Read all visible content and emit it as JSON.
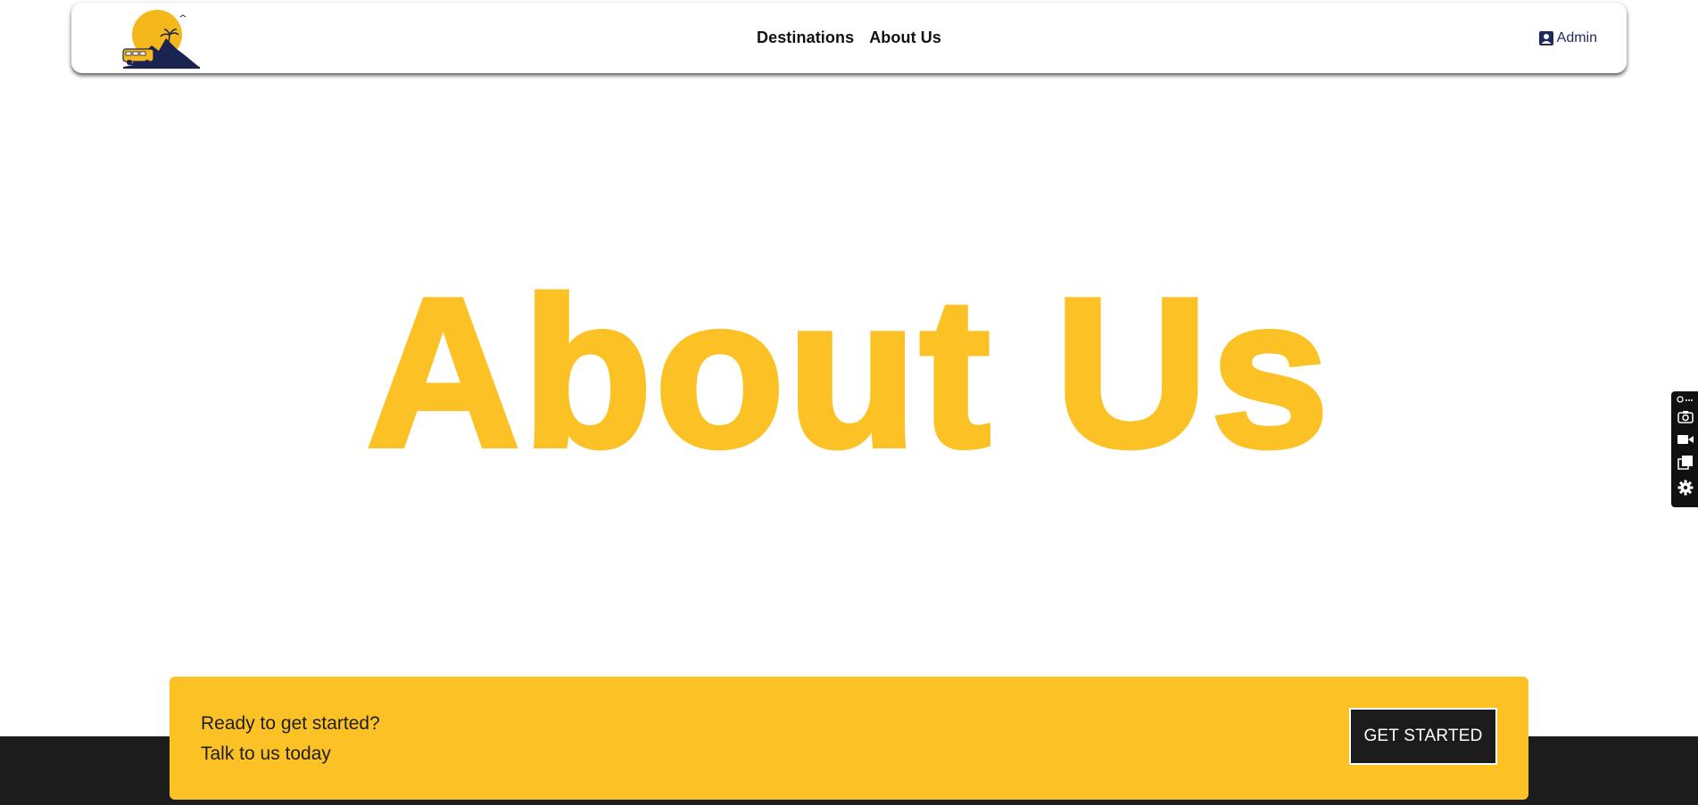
{
  "header": {
    "logo_name": "sunset-van-logo",
    "nav": [
      {
        "label": "Destinations"
      },
      {
        "label": "About Us"
      }
    ],
    "admin_label": "Admin",
    "admin_icon": "user-square-icon"
  },
  "hero": {
    "title": "About Us"
  },
  "cta": {
    "line1": "Ready to get started?",
    "line2": "Talk to us today",
    "button_label": "GET STARTED"
  },
  "toolbar": {
    "icons": [
      "link-more-icon",
      "camera-icon",
      "video-icon",
      "copy-icon",
      "settings-icon"
    ]
  },
  "colors": {
    "accent": "#fcc225",
    "dark": "#1c1c1c",
    "admin_text": "#1f2a5c"
  }
}
